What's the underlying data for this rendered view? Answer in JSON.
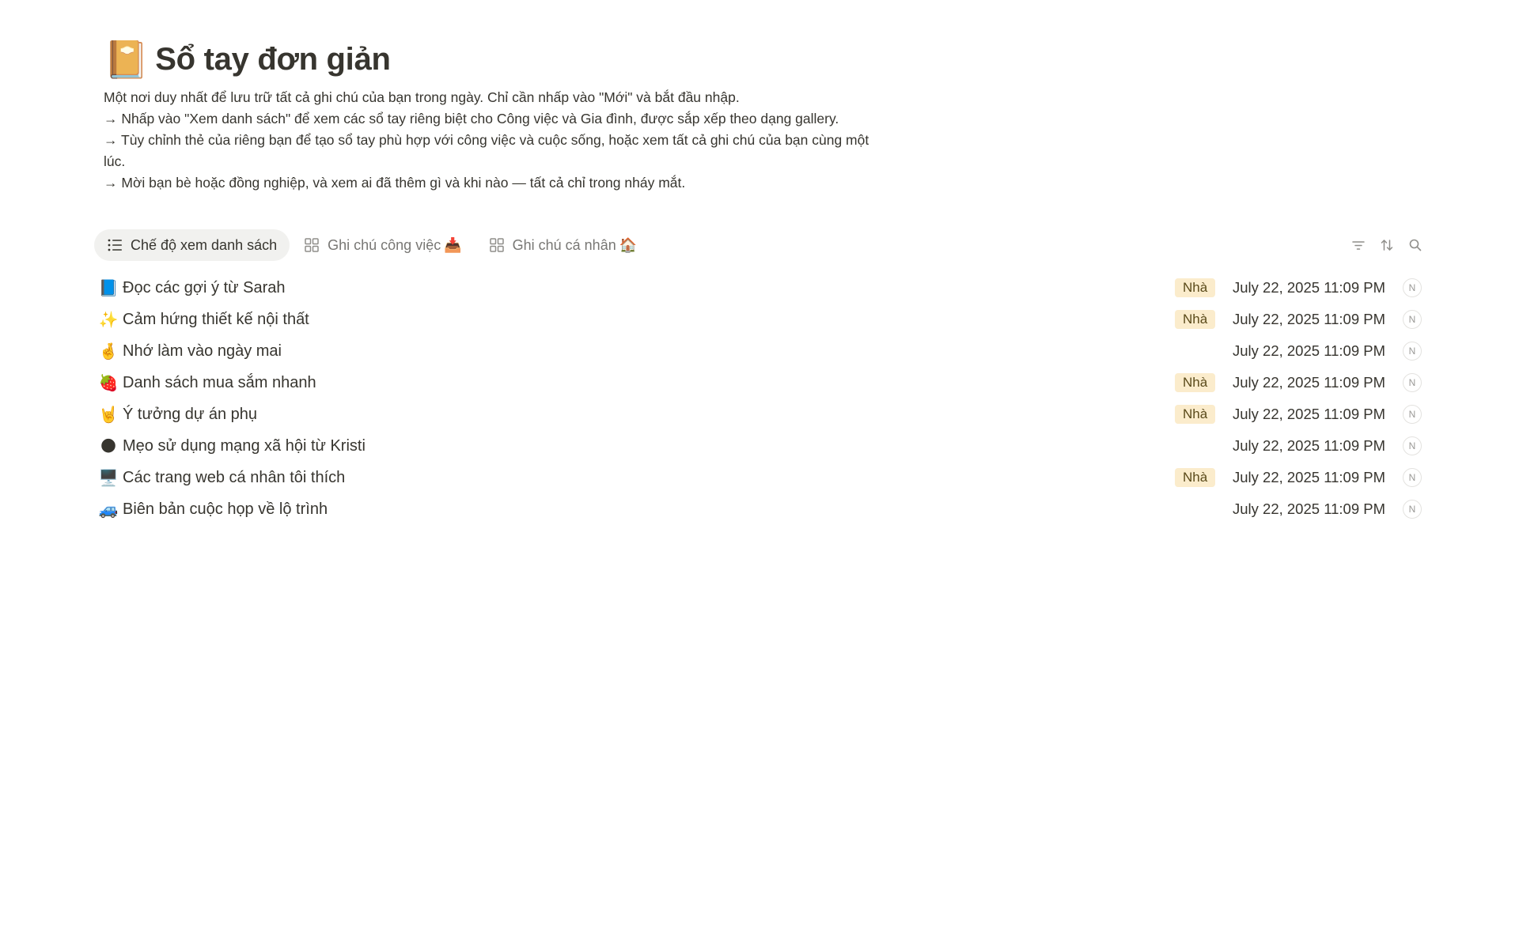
{
  "page": {
    "icon": "📔",
    "title": "Sổ tay đơn giản",
    "description": [
      "Một nơi duy nhất để lưu trữ tất cả ghi chú của bạn trong ngày. Chỉ cần nhấp vào \"Mới\" và bắt đầu nhập.",
      "→ Nhấp vào \"Xem danh sách\" để xem các sổ tay riêng biệt cho Công việc và Gia đình, được sắp xếp theo dạng gallery.",
      "→ Tùy chỉnh thẻ của riêng bạn để tạo sổ tay phù hợp với công việc và cuộc sống, hoặc xem tất cả ghi chú của bạn cùng một lúc.",
      "→ Mời bạn bè hoặc đồng nghiệp, và xem ai đã thêm gì và khi nào — tất cả chỉ trong nháy mắt."
    ]
  },
  "views": {
    "tabs": [
      {
        "label": "Chế độ xem danh sách",
        "icon": "list-icon",
        "emoji": "",
        "active": true
      },
      {
        "label": "Ghi chú công việc",
        "icon": "gallery-icon",
        "emoji": "📥",
        "active": false
      },
      {
        "label": "Ghi chú cá nhân",
        "icon": "gallery-icon",
        "emoji": "🏠",
        "active": false
      }
    ],
    "tools": [
      "filter-icon",
      "sort-icon",
      "search-icon"
    ]
  },
  "items": [
    {
      "emoji": "📘",
      "name": "Đọc các gợi ý từ Sarah",
      "tag": "Nhà",
      "date": "July 22, 2025 11:09 PM",
      "avatar": "N"
    },
    {
      "emoji": "✨",
      "name": "Cảm hứng thiết kế nội thất",
      "tag": "Nhà",
      "date": "July 22, 2025 11:09 PM",
      "avatar": "N"
    },
    {
      "emoji": "🤞",
      "name": "Nhớ làm vào ngày mai",
      "tag": "",
      "date": "July 22, 2025 11:09 PM",
      "avatar": "N"
    },
    {
      "emoji": "🍓",
      "name": "Danh sách mua sắm nhanh",
      "tag": "Nhà",
      "date": "July 22, 2025 11:09 PM",
      "avatar": "N"
    },
    {
      "emoji": "🤘",
      "name": "Ý tưởng dự án phụ",
      "tag": "Nhà",
      "date": "July 22, 2025 11:09 PM",
      "avatar": "N"
    },
    {
      "emoji": "🌑",
      "name": "Mẹo sử dụng mạng xã hội từ Kristi",
      "tag": "",
      "date": "July 22, 2025 11:09 PM",
      "avatar": "N"
    },
    {
      "emoji": "🖥️",
      "name": "Các trang web cá nhân tôi thích",
      "tag": "Nhà",
      "date": "July 22, 2025 11:09 PM",
      "avatar": "N"
    },
    {
      "emoji": "🚙",
      "name": "Biên bản cuộc họp về lộ trình",
      "tag": "",
      "date": "July 22, 2025 11:09 PM",
      "avatar": "N"
    }
  ]
}
